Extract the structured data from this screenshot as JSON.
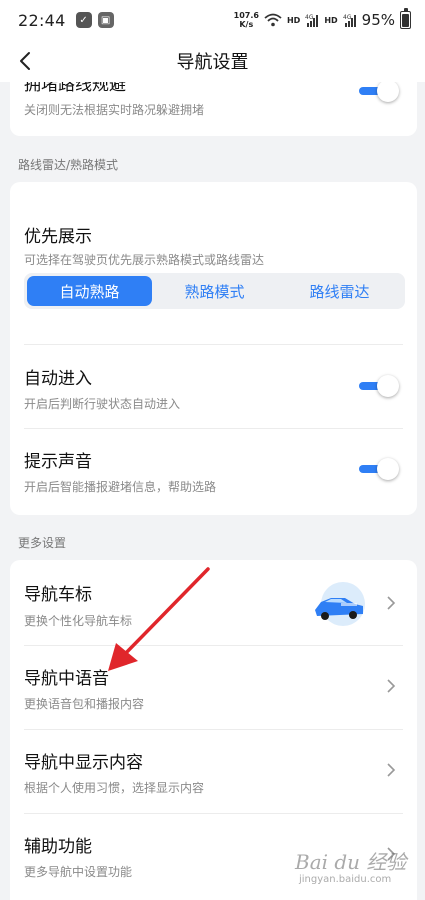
{
  "status_bar": {
    "time": "22:44",
    "net_speed_value": "107.6",
    "net_speed_unit": "K/s",
    "hd1": "HD",
    "hd2": "HD",
    "network_type": "4G",
    "battery_percent": "95%"
  },
  "header": {
    "title": "导航设置"
  },
  "top_card": {
    "cut_title": "拥堵路线规避",
    "subtitle": "关闭则无法根据实时路况躲避拥堵",
    "toggle_on": true
  },
  "radar_section": {
    "label": "路线雷达/熟路模式",
    "priority": {
      "title": "优先展示",
      "subtitle": "可选择在驾驶页优先展示熟路模式或路线雷达",
      "options": [
        "自动熟路",
        "熟路模式",
        "路线雷达"
      ],
      "selected": "自动熟路"
    },
    "auto_enter": {
      "title": "自动进入",
      "subtitle": "开启后判断行驶状态自动进入",
      "toggle_on": true
    },
    "sound": {
      "title": "提示声音",
      "subtitle": "开启后智能播报避堵信息，帮助选路",
      "toggle_on": true
    }
  },
  "more_section": {
    "label": "更多设置",
    "items": [
      {
        "title": "导航车标",
        "subtitle": "更换个性化导航车标"
      },
      {
        "title": "导航中语音",
        "subtitle": "更换语音包和播报内容"
      },
      {
        "title": "导航中显示内容",
        "subtitle": "根据个人使用习惯，选择显示内容"
      },
      {
        "title": "辅助功能",
        "subtitle": "更多导航中设置功能"
      }
    ]
  },
  "watermark": {
    "brand": "Bai du 经验",
    "url": "jingyan.baidu.com"
  },
  "colors": {
    "accent": "#2f7ff5",
    "background": "#f2f3f5",
    "annotation": "#e0262b"
  }
}
